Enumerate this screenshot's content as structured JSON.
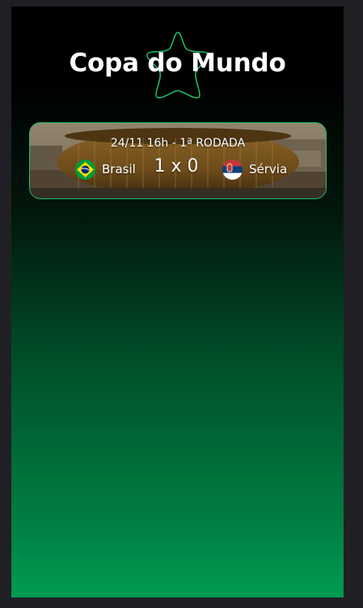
{
  "header": {
    "title": "Copa do Mundo",
    "logo_icon": "star-outline-icon",
    "accent_color": "#1ec06a"
  },
  "matches": [
    {
      "info": "24/11 16h - 1ª RODADA",
      "home": {
        "name": "Brasil",
        "flag_icon": "brazil-flag-icon"
      },
      "score": "1 x 0",
      "away": {
        "name": "Sérvia",
        "flag_icon": "serbia-flag-icon"
      }
    }
  ],
  "theme": {
    "background_top": "#000000",
    "background_bottom": "#009a52",
    "card_border": "#1ec06a"
  }
}
